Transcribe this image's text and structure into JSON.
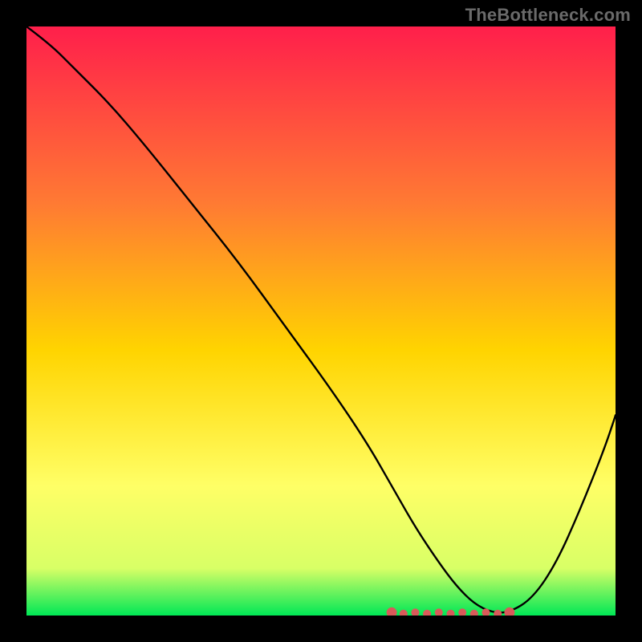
{
  "watermark": "TheBottleneck.com",
  "colors": {
    "gradient_top": "#ff1f4b",
    "gradient_mid_upper": "#ff7a33",
    "gradient_mid": "#ffd400",
    "gradient_mid_lower": "#ffff66",
    "gradient_lower": "#d8ff66",
    "gradient_bottom": "#00e756",
    "curve": "#000000",
    "marker": "#d85a5a",
    "frame": "#000000"
  },
  "chart_data": {
    "type": "line",
    "title": "",
    "xlabel": "",
    "ylabel": "",
    "xlim": [
      0,
      100
    ],
    "ylim": [
      0,
      100
    ],
    "series": [
      {
        "name": "bottleneck-curve",
        "x": [
          0,
          4,
          8,
          14,
          20,
          28,
          36,
          44,
          52,
          58,
          62,
          66,
          70,
          73,
          76,
          79,
          82,
          86,
          90,
          94,
          98,
          100
        ],
        "y": [
          100,
          97,
          93,
          87,
          80,
          70,
          60,
          49,
          38,
          29,
          22,
          15,
          9,
          5,
          2,
          0.5,
          0.5,
          3,
          9,
          18,
          28,
          34
        ]
      }
    ],
    "markers": {
      "name": "highlight-band",
      "x_range": [
        62,
        82
      ],
      "y": 0.5,
      "note": "flat-bottom optimal region"
    }
  }
}
